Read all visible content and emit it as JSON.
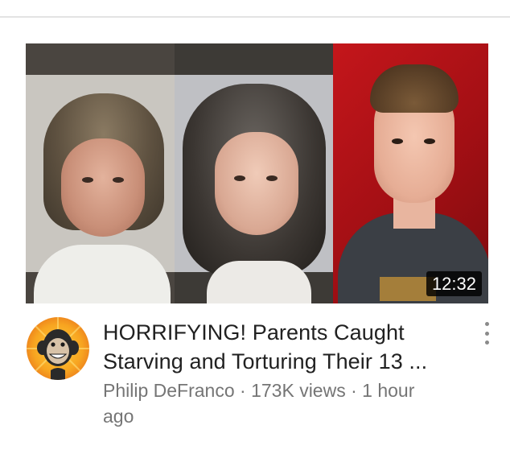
{
  "video": {
    "duration": "12:32",
    "title_line1": "HORRIFYING! Parents Caught",
    "title_line2": "Starving and Torturing Their 13 ...",
    "channel": "Philip DeFranco",
    "separator": "·",
    "views": "173K views",
    "age_part1": "1 hour",
    "age_part2": "ago"
  },
  "icons": {
    "channel_avatar": "monkey-logo-avatar",
    "menu": "more-vert-icon"
  },
  "colors": {
    "title_text": "#212121",
    "meta_text": "#757575",
    "thumbnail_red": "#c4161b",
    "avatar_orange": "#f7a420"
  }
}
